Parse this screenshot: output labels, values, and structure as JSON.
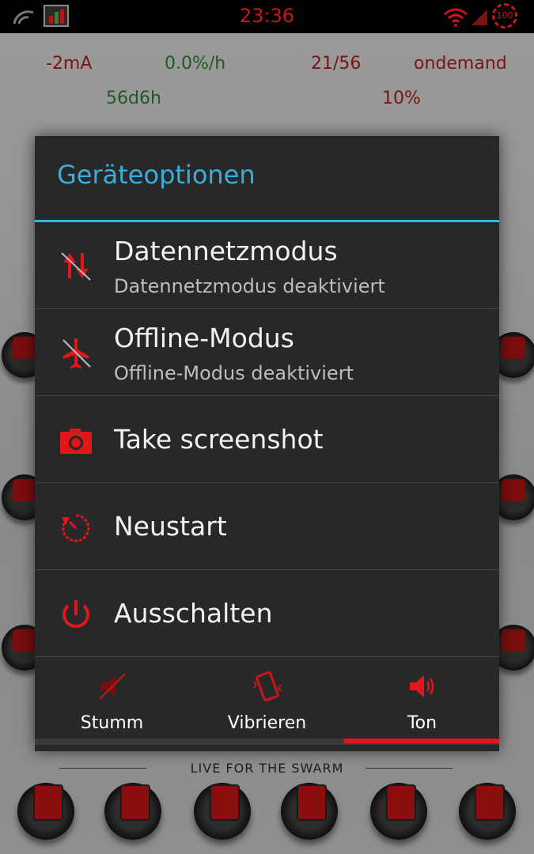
{
  "status_bar": {
    "time": "23:36",
    "icons": [
      "signal-icon",
      "battery-widget-icon",
      "wifi-icon",
      "cell-signal-icon",
      "battery-level-icon"
    ],
    "battery_level": "100"
  },
  "home": {
    "stats_row1": [
      "-2mA",
      "0.0%/h",
      "21/56",
      "ondemand"
    ],
    "stats_row2": [
      "56d6h",
      "10%"
    ],
    "swarm_label": "LIVE FOR THE SWARM",
    "dock_icons": [
      "app-icon-1",
      "app-icon-2",
      "app-icon-3",
      "app-icon-4",
      "app-icon-5",
      "app-icon-6"
    ]
  },
  "dialog": {
    "title": "Geräteoptionen",
    "options": [
      {
        "label": "Datennetzmodus",
        "sub": "Datennetzmodus deaktiviert",
        "icon": "data-off-icon"
      },
      {
        "label": "Offline-Modus",
        "sub": "Offline-Modus deaktiviert",
        "icon": "airplane-off-icon"
      },
      {
        "label": "Take screenshot",
        "sub": "",
        "icon": "camera-icon"
      },
      {
        "label": "Neustart",
        "sub": "",
        "icon": "reboot-icon"
      },
      {
        "label": "Ausschalten",
        "sub": "",
        "icon": "power-icon"
      }
    ],
    "sound_modes": [
      {
        "label": "Stumm",
        "icon": "mute-icon"
      },
      {
        "label": "Vibrieren",
        "icon": "vibrate-icon"
      },
      {
        "label": "Ton",
        "icon": "sound-icon"
      }
    ],
    "active_sound_mode": "Ton",
    "accent_color": "#33b5e5",
    "icon_color": "#e0161b"
  }
}
